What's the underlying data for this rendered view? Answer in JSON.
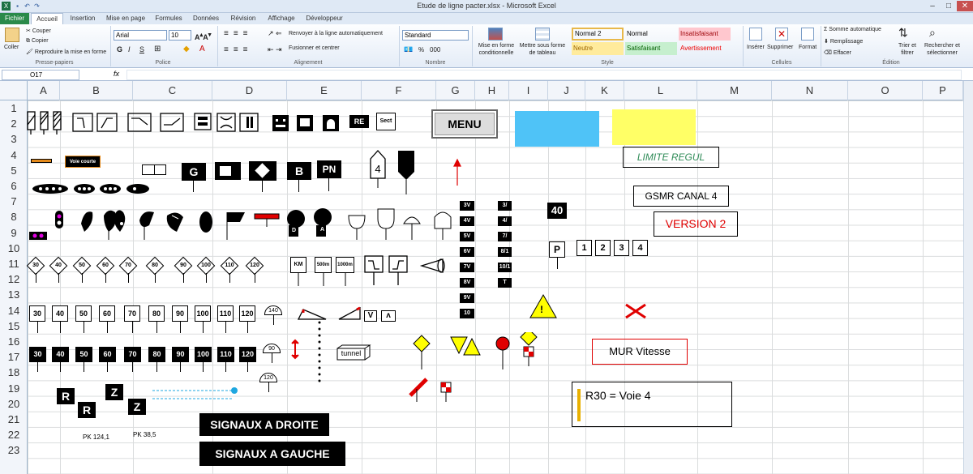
{
  "window": {
    "title": "Etude de ligne pacter.xlsx - Microsoft Excel",
    "qat_icons": [
      "excel-icon",
      "save-icon",
      "undo-icon",
      "redo-icon"
    ]
  },
  "ribbon": {
    "tabs": [
      "Fichier",
      "Accueil",
      "Insertion",
      "Mise en page",
      "Formules",
      "Données",
      "Révision",
      "Affichage",
      "Développeur"
    ],
    "active_tab": "Accueil",
    "clipboard": {
      "paste": "Coller",
      "cut": "Couper",
      "copy": "Copier",
      "painter": "Reproduire la mise en forme",
      "group": "Presse-papiers"
    },
    "font": {
      "name": "Arial",
      "size": "10",
      "group": "Police",
      "bold": "G",
      "italic": "I",
      "underline": "S"
    },
    "alignment": {
      "wrap": "Renvoyer à la ligne automatiquement",
      "merge": "Fusionner et centrer",
      "group": "Alignement"
    },
    "number": {
      "format": "Standard",
      "group": "Nombre",
      "pct": "%",
      "thousands": "000"
    },
    "styles": {
      "cond": "Mise en forme conditionnelle",
      "table": "Mettre sous forme de tableau",
      "cells": [
        "Normal 2",
        "Normal",
        "Insatisfaisant",
        "Neutre",
        "Satisfaisant",
        "Avertissement"
      ],
      "group": "Style"
    },
    "cells": {
      "insert": "Insérer",
      "delete": "Supprimer",
      "format": "Format",
      "group": "Cellules"
    },
    "editing": {
      "autosum": "Somme automatique",
      "fill": "Remplissage",
      "clear": "Effacer",
      "sort": "Trier et filtrer",
      "find": "Rechercher et sélectionner",
      "group": "Édition"
    },
    "colors": {
      "insatisfaisant_bg": "#ffc7ce",
      "neutre_bg": "#ffeb9c",
      "satisfaisant_bg": "#c6efce"
    }
  },
  "formula_bar": {
    "name_box": "O17",
    "fx": "fx",
    "value": ""
  },
  "sheet": {
    "columns": [
      "A",
      "B",
      "C",
      "D",
      "E",
      "F",
      "G",
      "H",
      "I",
      "J",
      "K",
      "L",
      "M",
      "N",
      "O",
      "P"
    ],
    "rows": [
      "1",
      "2",
      "3",
      "4",
      "5",
      "6",
      "7",
      "8",
      "9",
      "10",
      "11",
      "12",
      "13",
      "14",
      "15",
      "16",
      "17",
      "18",
      "19",
      "20",
      "21",
      "22",
      "23"
    ]
  },
  "shapes": {
    "menu": "MENU",
    "limite_regul": "LIMITE REGUL",
    "gsmr": "GSMR CANAL  4",
    "version": "VERSION 2",
    "mur": "MUR Vitesse",
    "note": "R30 = Voie 4",
    "sig_droite": "SIGNAUX A DROITE",
    "sig_gauche": "SIGNAUX A GAUCHE",
    "pk1": "PK 124,1",
    "pk2": "PK 38,5",
    "voie_courte": "Voie courte",
    "sect": "Sect",
    "re": "RE",
    "pn": "PN",
    "g": "G",
    "b": "B",
    "four": "4",
    "km": "KM",
    "m500": "500m",
    "m1000": "1000m",
    "tunnel": "tunnel",
    "forty": "40",
    "p": "P",
    "num_boxes": [
      "1",
      "2",
      "3",
      "4"
    ],
    "voie_tags": [
      "3V",
      "4V",
      "5V",
      "6V",
      "7V",
      "8V",
      "9V",
      "10"
    ],
    "frac_tags": [
      "3/",
      "4/",
      "7/",
      "8/1",
      "10/1",
      "T"
    ],
    "diamonds": [
      "30",
      "40",
      "50",
      "60",
      "70",
      "80",
      "90",
      "100",
      "110",
      "120"
    ],
    "speed_boxes": [
      "30",
      "40",
      "50",
      "60",
      "70",
      "80",
      "90",
      "100",
      "110",
      "120"
    ],
    "speed_blacks": [
      "30",
      "40",
      "50",
      "60",
      "70",
      "80",
      "90",
      "100",
      "110",
      "120"
    ],
    "small_round": [
      "140",
      "90",
      "120"
    ],
    "d_label": "D",
    "a_label": "A",
    "v_label": "V",
    "rz": [
      "R",
      "R",
      "Z",
      "Z"
    ],
    "excl": "!",
    "colors": {
      "cyan": "#4fc3f7",
      "yellow": "#ffff66",
      "red": "#e00000",
      "orange": "#e48a1b",
      "green_text": "#2e8b57"
    }
  }
}
